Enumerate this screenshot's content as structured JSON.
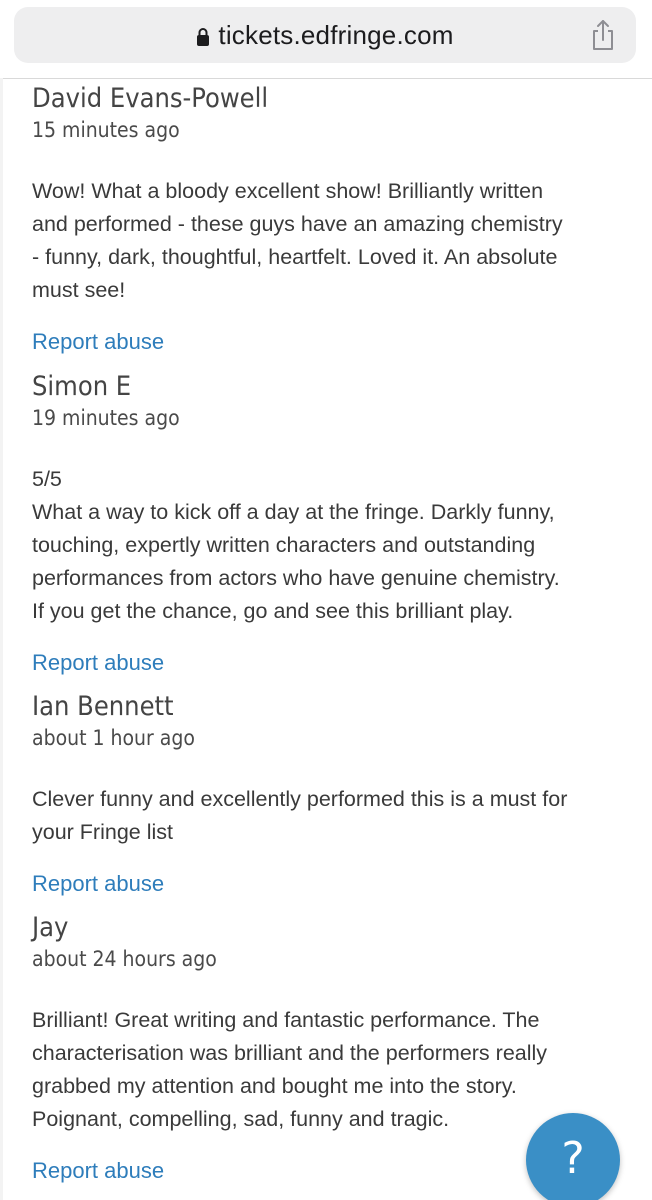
{
  "browser": {
    "url": "tickets.edfringe.com",
    "lock_icon": "lock-icon",
    "share_icon": "share-icon"
  },
  "comments": [
    {
      "author": "David Evans-Powell",
      "time": "15 minutes ago",
      "lines": [
        "Wow! What a bloody excellent show! Brilliantly written",
        "and performed - these guys have an amazing chemistry",
        "- funny, dark, thoughtful, heartfelt. Loved it. An absolute",
        "must see!"
      ],
      "report": "Report abuse"
    },
    {
      "author": "Simon E",
      "time": "19 minutes ago",
      "lines": [
        "5/5",
        "What a way to kick off a day at the fringe. Darkly funny,",
        "touching, expertly written characters and outstanding",
        "performances from actors who have genuine chemistry.",
        "If you get the chance, go and see this brilliant play."
      ],
      "report": "Report abuse"
    },
    {
      "author": "Ian Bennett",
      "time": "about 1 hour ago",
      "lines": [
        "Clever funny and excellently performed this is a must for",
        "your Fringe list"
      ],
      "report": "Report abuse"
    },
    {
      "author": "Jay",
      "time": "about 24 hours ago",
      "lines": [
        "Brilliant! Great writing and fantastic performance. The",
        "characterisation was brilliant and the performers really",
        "grabbed my attention and bought me into the story.",
        "Poignant, compelling, sad, funny and tragic."
      ],
      "report": "Report abuse"
    }
  ],
  "help": {
    "glyph": "?",
    "icon": "question-icon"
  },
  "colors": {
    "link": "#2e7dbb",
    "help_button": "#3a8fc6",
    "url_pill": "#eeeeef"
  }
}
